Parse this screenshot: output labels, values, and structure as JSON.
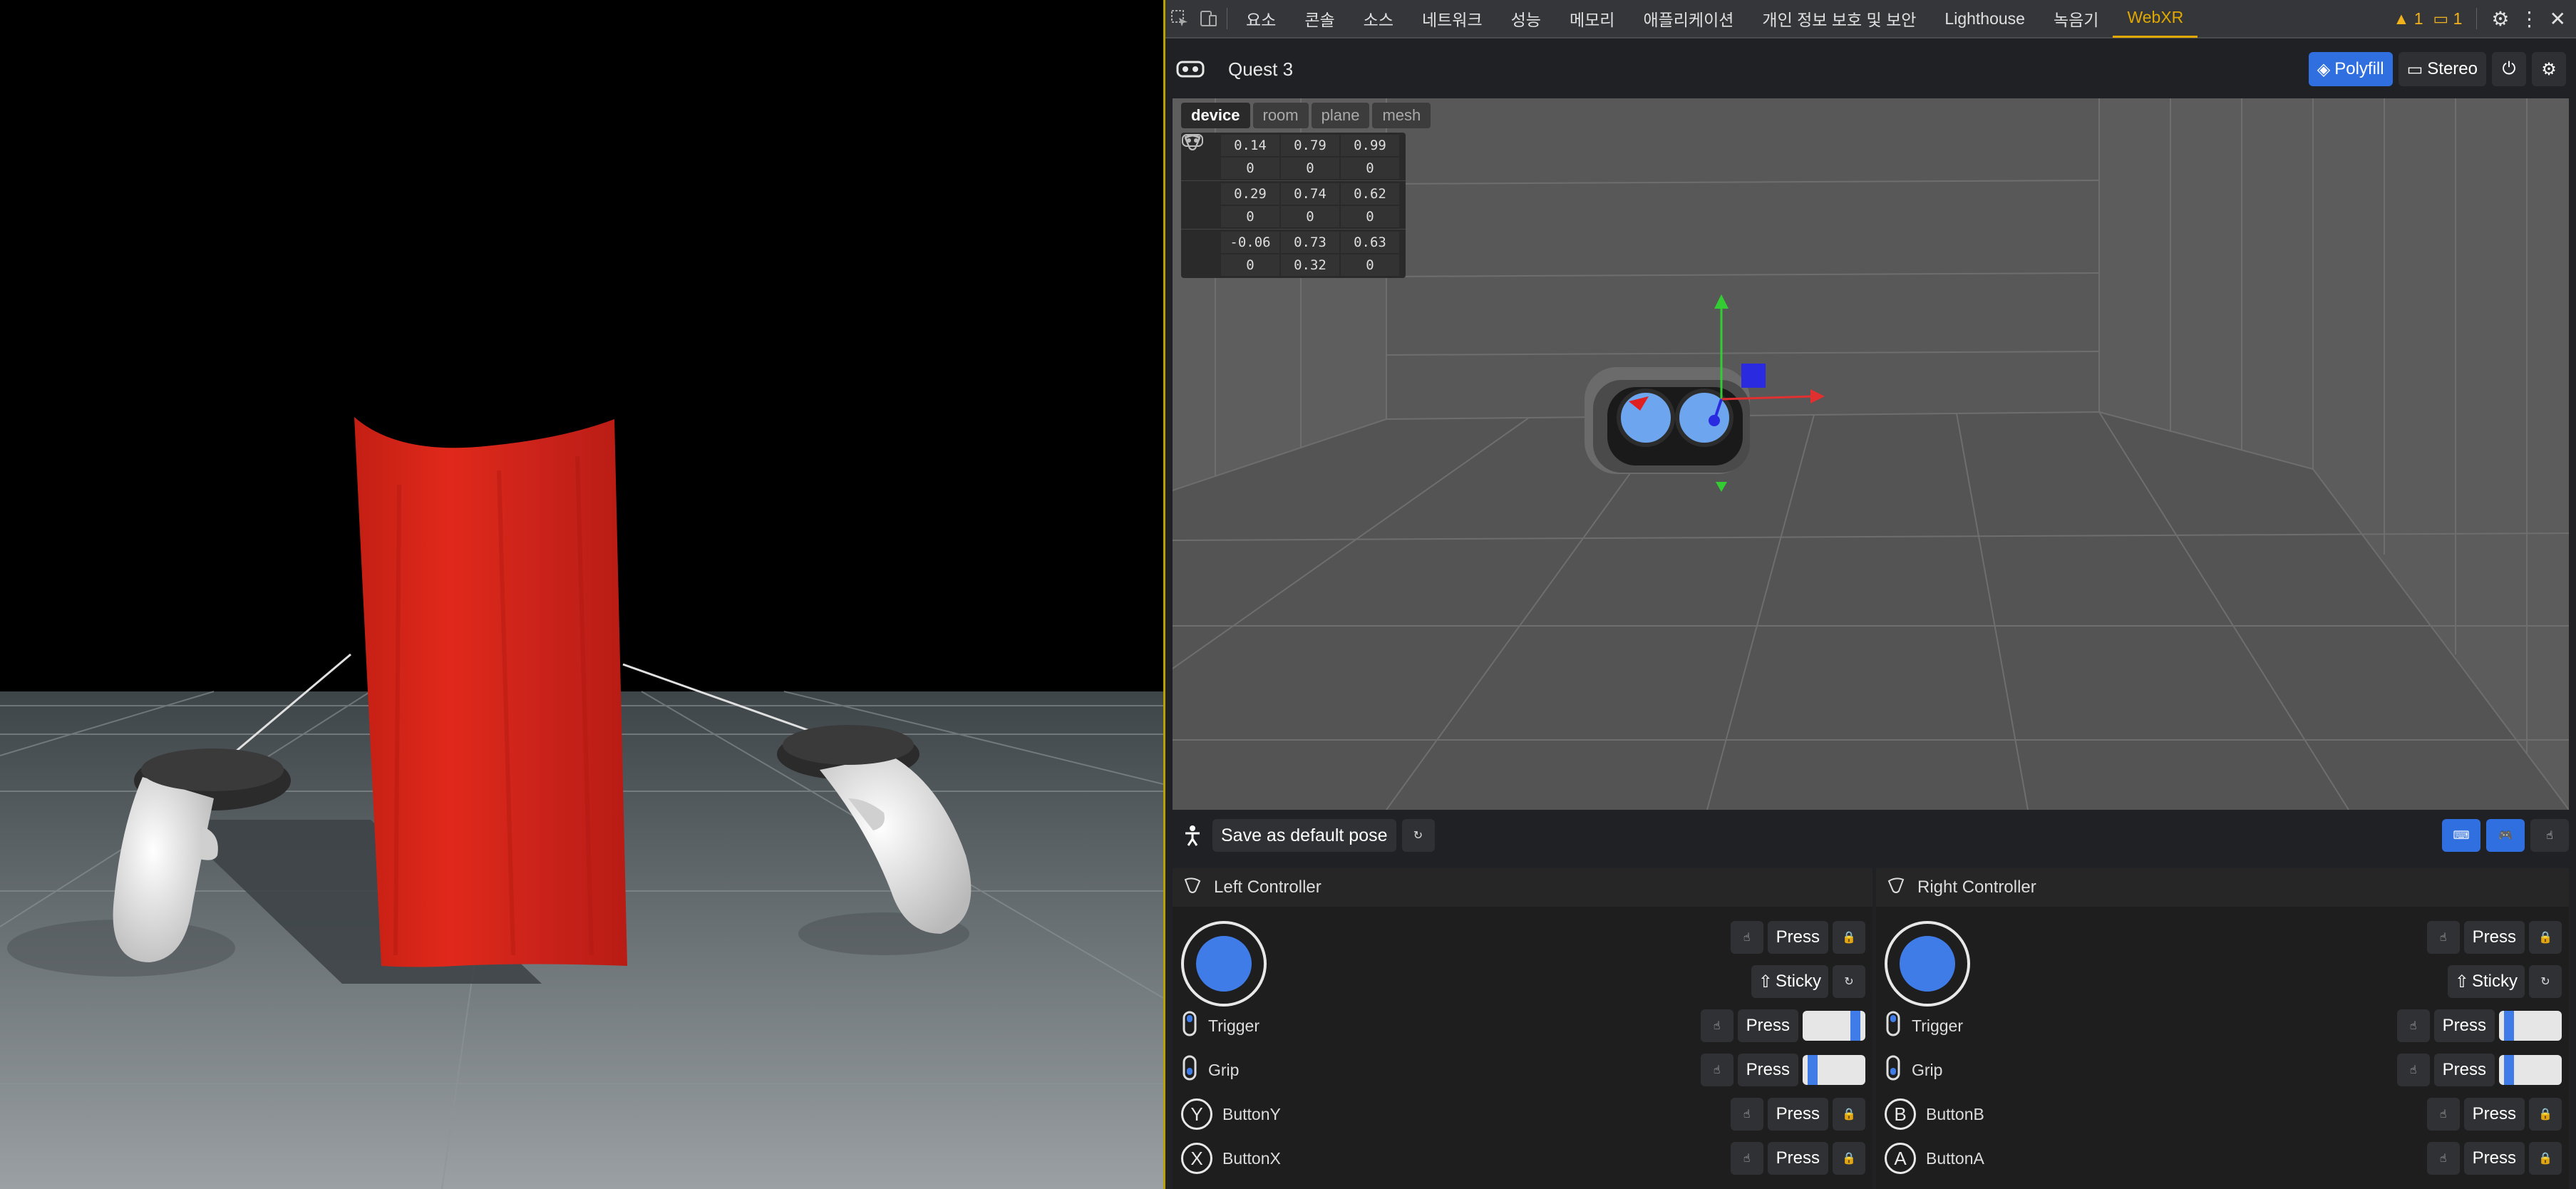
{
  "devtools_tabs": [
    "요소",
    "콘솔",
    "소스",
    "네트워크",
    "성능",
    "메모리",
    "애플리케이션",
    "개인 정보 보호 및 보안",
    "Lighthouse",
    "녹음기",
    "WebXR"
  ],
  "active_tab": "WebXR",
  "warnings": "1",
  "messages": "1",
  "device_name": "Quest 3",
  "buttons": {
    "polyfill": "Polyfill",
    "stereo": "Stereo",
    "save_pose": "Save as default pose"
  },
  "subtabs": [
    "device",
    "room",
    "plane",
    "mesh"
  ],
  "active_subtab": "device",
  "poses": [
    {
      "icon": "headset-icon",
      "pos": [
        "0.14",
        "0.79",
        "0.99"
      ],
      "rot": [
        "0",
        "0",
        "0"
      ]
    },
    {
      "icon": "left-controller-icon",
      "pos": [
        "0.29",
        "0.74",
        "0.62"
      ],
      "rot": [
        "0",
        "0",
        "0"
      ]
    },
    {
      "icon": "right-controller-icon",
      "pos": [
        "-0.06",
        "0.73",
        "0.63"
      ],
      "rot": [
        "0",
        "0.32",
        "0"
      ]
    }
  ],
  "left_controller": {
    "title": "Left Controller",
    "press": "Press",
    "sticky": "Sticky",
    "trigger": "Trigger",
    "grip": "Grip",
    "button_top": "ButtonY",
    "button_bottom": "ButtonX",
    "letter_top": "Y",
    "letter_bottom": "X",
    "trigger_value": 0.9,
    "grip_value": 0.1
  },
  "right_controller": {
    "title": "Right Controller",
    "press": "Press",
    "sticky": "Sticky",
    "trigger": "Trigger",
    "grip": "Grip",
    "button_top": "ButtonB",
    "button_bottom": "ButtonA",
    "letter_top": "B",
    "letter_bottom": "A",
    "trigger_value": 0.1,
    "grip_value": 0.1
  },
  "colors": {
    "accent": "#2f6fe0",
    "tab_active": "#e0a800",
    "cloth": "#d8251a"
  }
}
